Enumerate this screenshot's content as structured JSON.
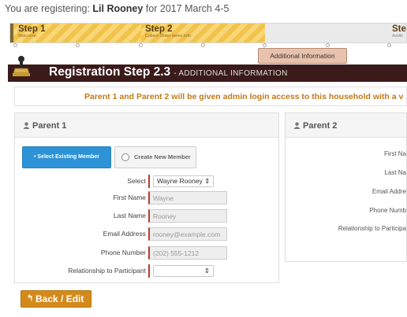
{
  "registering": {
    "prefix": "You are registering: ",
    "name": "Lil Rooney",
    "suffix": " for 2017 March 4-5"
  },
  "steps": [
    {
      "title": "Step 1",
      "subtitle": "Welcome"
    },
    {
      "title": "Step 2",
      "subtitle": "Collect Order Items Info"
    },
    {
      "title": "Ste",
      "subtitle": "Additi"
    }
  ],
  "tooltip": "Additional Information",
  "header": {
    "title": "Registration Step 2.3",
    "subtitle": "- ADDITIONAL INFORMATION"
  },
  "info_text": "Parent 1 and Parent 2 will be given admin login access to this household with a v",
  "parent1": {
    "title": "Parent 1",
    "btn_existing": "Select Existing Member",
    "btn_new": "Create New Member",
    "select_label": "Select",
    "select_value": "Wayne Rooney",
    "fields": {
      "first_name": {
        "label": "First Name",
        "value": "Wayne"
      },
      "last_name": {
        "label": "Last Name",
        "value": "Rooney"
      },
      "email": {
        "label": "Email Address",
        "value": "rooney@example.com"
      },
      "phone": {
        "label": "Phone Number",
        "value": "(202) 555-1212"
      }
    },
    "relationship_label": "Relationship to Participant",
    "relationship_value": ""
  },
  "parent2": {
    "title": "Parent 2",
    "labels": [
      "First Na",
      "Last Na",
      "Email Addre",
      "Phone Numb",
      "Relationship to Participa"
    ]
  },
  "back_button": "Back / Edit",
  "colors": {
    "step_stripe": "#f3c24a",
    "header_bg": "#3b1a1a",
    "accent_orange": "#d48a1b",
    "primary_blue": "#2d92d6",
    "required_red": "#c0392b"
  }
}
